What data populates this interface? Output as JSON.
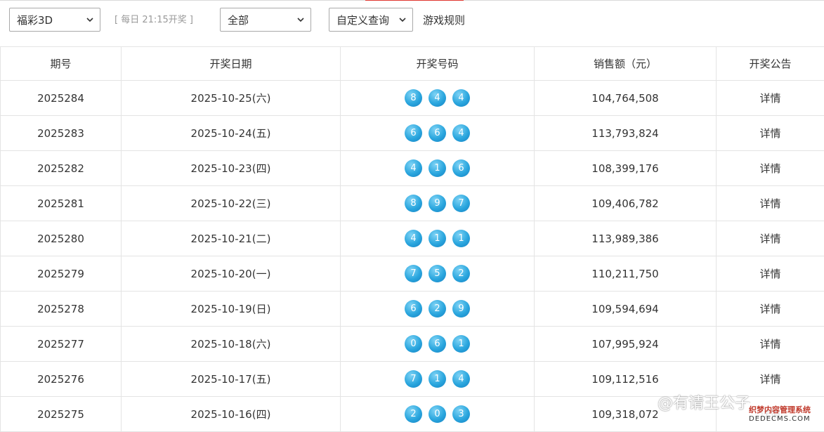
{
  "filters": {
    "lottery_select": "福彩3D",
    "draw_time_hint": "[ 每日 21:15开奖 ]",
    "range_select": "全部",
    "custom_query_select": "自定义查询",
    "rules_link": "游戏规则"
  },
  "table": {
    "headers": [
      "期号",
      "开奖日期",
      "开奖号码",
      "销售额（元）",
      "开奖公告"
    ],
    "rows": [
      {
        "issue": "2025284",
        "date": "2025-10-25(六)",
        "numbers": [
          "8",
          "4",
          "4"
        ],
        "sales": "104,764,508",
        "notice": "详情"
      },
      {
        "issue": "2025283",
        "date": "2025-10-24(五)",
        "numbers": [
          "6",
          "6",
          "4"
        ],
        "sales": "113,793,824",
        "notice": "详情"
      },
      {
        "issue": "2025282",
        "date": "2025-10-23(四)",
        "numbers": [
          "4",
          "1",
          "6"
        ],
        "sales": "108,399,176",
        "notice": "详情"
      },
      {
        "issue": "2025281",
        "date": "2025-10-22(三)",
        "numbers": [
          "8",
          "9",
          "7"
        ],
        "sales": "109,406,782",
        "notice": "详情"
      },
      {
        "issue": "2025280",
        "date": "2025-10-21(二)",
        "numbers": [
          "4",
          "1",
          "1"
        ],
        "sales": "113,989,386",
        "notice": "详情"
      },
      {
        "issue": "2025279",
        "date": "2025-10-20(一)",
        "numbers": [
          "7",
          "5",
          "2"
        ],
        "sales": "110,211,750",
        "notice": "详情"
      },
      {
        "issue": "2025278",
        "date": "2025-10-19(日)",
        "numbers": [
          "6",
          "2",
          "9"
        ],
        "sales": "109,594,694",
        "notice": "详情"
      },
      {
        "issue": "2025277",
        "date": "2025-10-18(六)",
        "numbers": [
          "0",
          "6",
          "1"
        ],
        "sales": "107,995,924",
        "notice": "详情"
      },
      {
        "issue": "2025276",
        "date": "2025-10-17(五)",
        "numbers": [
          "7",
          "1",
          "4"
        ],
        "sales": "109,112,516",
        "notice": "详情"
      },
      {
        "issue": "2025275",
        "date": "2025-10-16(四)",
        "numbers": [
          "2",
          "0",
          "3"
        ],
        "sales": "109,318,072",
        "notice": "详情"
      }
    ]
  },
  "watermark": {
    "author": "@有请王公子",
    "cms_line1": "织梦内容管理系统",
    "cms_line2": "DEDECMS.COM"
  },
  "colors": {
    "ball": "#2aa6de",
    "border": "#e4e4e4",
    "accent_line": "#e0362e"
  },
  "icons": [
    "chevron-down-icon"
  ]
}
